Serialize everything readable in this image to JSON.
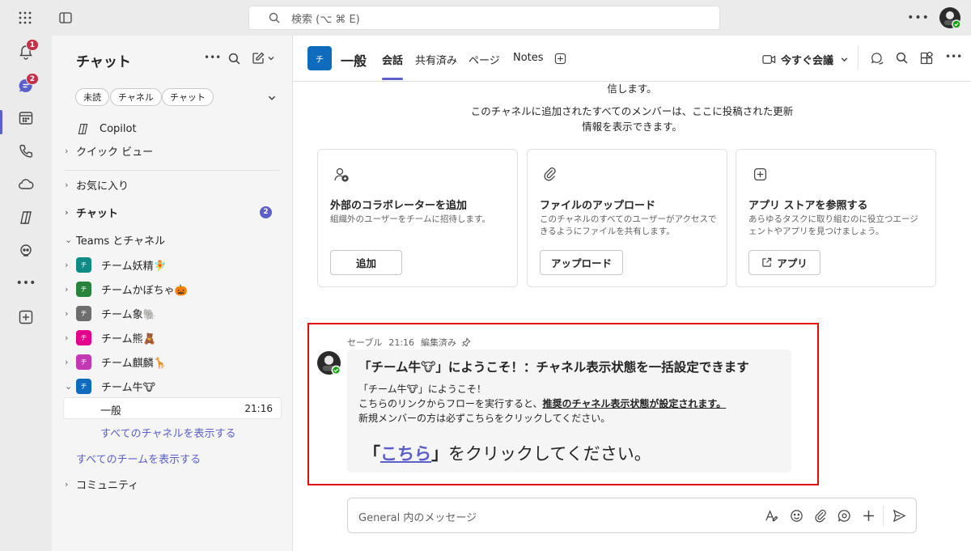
{
  "topbar": {
    "search_placeholder": "検索 (⌥ ⌘ E)"
  },
  "rail": {
    "activity_badge": "1",
    "chat_badge": "2"
  },
  "sidebar": {
    "title": "チャット",
    "filters": [
      "未読",
      "チャネル",
      "チャット"
    ],
    "copilot": "Copilot",
    "quick_view": "クイック ビュー",
    "favorites": "お気に入り",
    "chat_section": "チャット",
    "chat_badge": "2",
    "teams_section": "Teams とチャネル",
    "teams": [
      {
        "name": "チーム妖精🧚",
        "color": "#0f8a87"
      },
      {
        "name": "チームかぼちゃ🎃",
        "color": "#26843b"
      },
      {
        "name": "チーム象🐘",
        "color": "#6e6e6e"
      },
      {
        "name": "チーム熊🧸",
        "color": "#e3008c"
      },
      {
        "name": "チーム麒麟🦒",
        "color": "#c239b3"
      },
      {
        "name": "チーム牛🐮",
        "color": "#0f6cbd"
      }
    ],
    "channel_general": "一般",
    "channel_time": "21:16",
    "show_all_channels": "すべてのチャネルを表示する",
    "show_all_teams": "すべてのチームを表示する",
    "community": "コミュニティ"
  },
  "header": {
    "team_initial": "チ",
    "channel_name": "一般",
    "tabs": [
      "会話",
      "共有済み",
      "ページ",
      "Notes"
    ],
    "meet_now": "今すぐ会議"
  },
  "intro": {
    "line0": "信します。",
    "line1": "このチャネルに追加されたすべてのメンバーは、ここに投稿された更新",
    "line2": "情報を表示できます。"
  },
  "cards": [
    {
      "title": "外部のコラボレーターを追加",
      "desc": "組織外のユーザーをチームに招待します。",
      "button": "追加",
      "icon": "add-person-icon"
    },
    {
      "title": "ファイルのアップロード",
      "desc": "このチャネルのすべてのユーザーがアクセスできるようにファイルを共有します。",
      "button": "アップロード",
      "icon": "paperclip-icon"
    },
    {
      "title": "アプリ ストアを参照する",
      "desc": "あらゆるタスクに取り組むのに役立つエージェントやアプリを見つけましょう。",
      "button": "アプリ",
      "icon": "add-app-icon"
    }
  ],
  "message": {
    "author": "セーブル",
    "time": "21:16",
    "edited": "編集済み",
    "title": "「チーム牛🐮」にようこそ！：チャネル表示状態を一括設定できます",
    "line1": "「チーム牛🐮」にようこそ！",
    "line2_prefix": "こちらのリンクからフローを実行すると、",
    "line2_bold": "推奨のチャネル表示状態が設定されます。",
    "line3": "新規メンバーの方は必ずこちらをクリックしてください。",
    "cta_open": "「",
    "cta_link": "こちら",
    "cta_close": "」",
    "cta_rest": "をクリックしてください。"
  },
  "compose": {
    "placeholder": "General 内のメッセージ"
  },
  "colors": {
    "accent": "#5b5fc7",
    "team_blue": "#0f6cbd",
    "highlight": "#e00b0b",
    "link": "#5b5fc7"
  }
}
